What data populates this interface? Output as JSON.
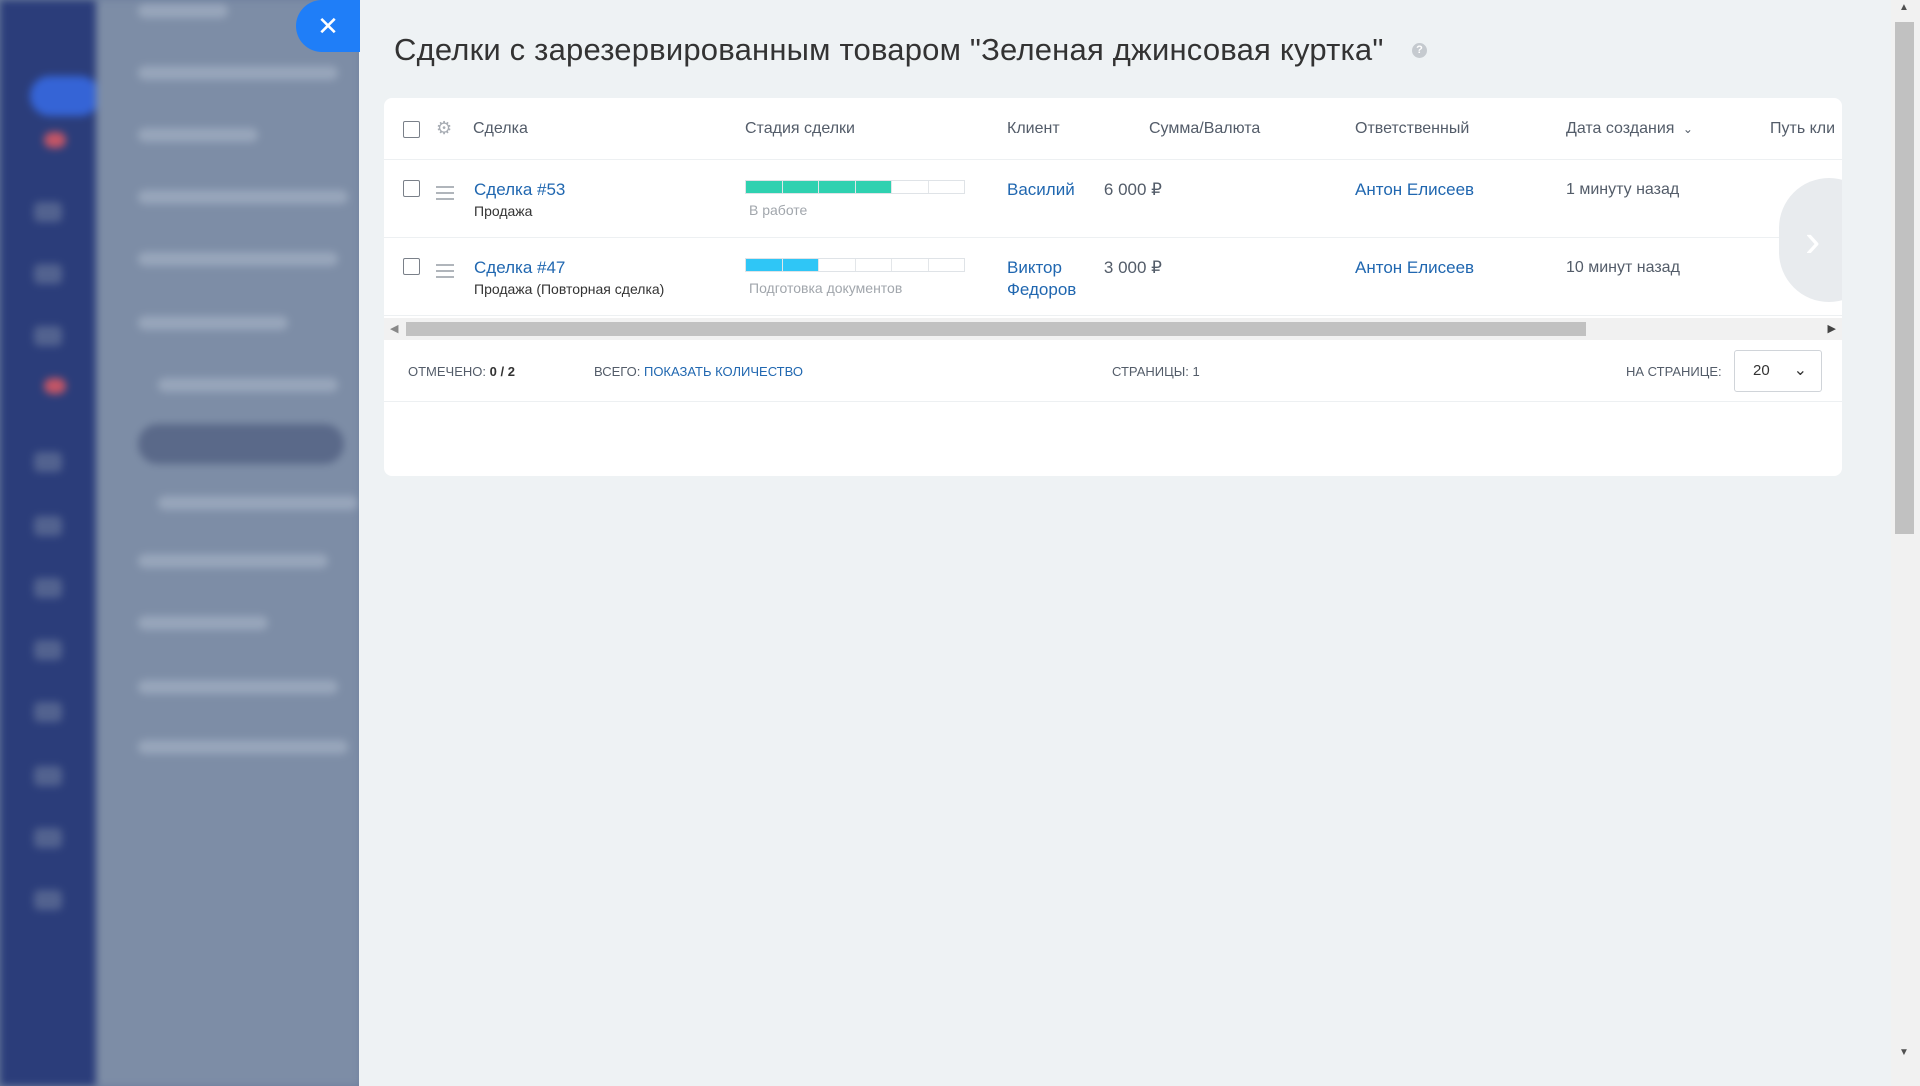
{
  "slider": {
    "close_glyph": "✕",
    "title": "Сделки с зарезервированным товаром \"Зеленая джинсовая куртка\"",
    "help_glyph": "?"
  },
  "grid": {
    "columns": [
      "Сделка",
      "Стадия сделки",
      "Клиент",
      "Сумма/Валюта",
      "Ответственный",
      "Дата создания",
      "Путь кли"
    ],
    "sort_column": "Дата создания",
    "rows": [
      {
        "deal": "Сделка #53",
        "category": "Продажа",
        "stage": "В работе",
        "stage_progress": 0.67,
        "stage_color": "#2fd1b0",
        "client": "Василий",
        "amount": "6 000 ₽",
        "responsible": "Антон Елисеев",
        "created": "1 минуту назад"
      },
      {
        "deal": "Сделка #47",
        "category": "Продажа (Повторная сделка)",
        "stage": "Подготовка документов",
        "stage_progress": 0.33,
        "stage_color": "#2fc6f6",
        "client_line1": "Виктор",
        "client_line2": "Федоров",
        "amount": "3 000 ₽",
        "responsible": "Антон Елисеев",
        "created": "10 минут назад"
      }
    ]
  },
  "footer": {
    "selected_label": "ОТМЕЧЕНО:",
    "selected_value": "0 / 2",
    "total_label": "ВСЕГО:",
    "total_link": "ПОКАЗАТЬ КОЛИЧЕСТВО",
    "pages_label": "СТРАНИЦЫ:",
    "pages_value": "1",
    "per_page_label": "НА СТРАНИЦЕ:",
    "per_page_value": "20"
  }
}
